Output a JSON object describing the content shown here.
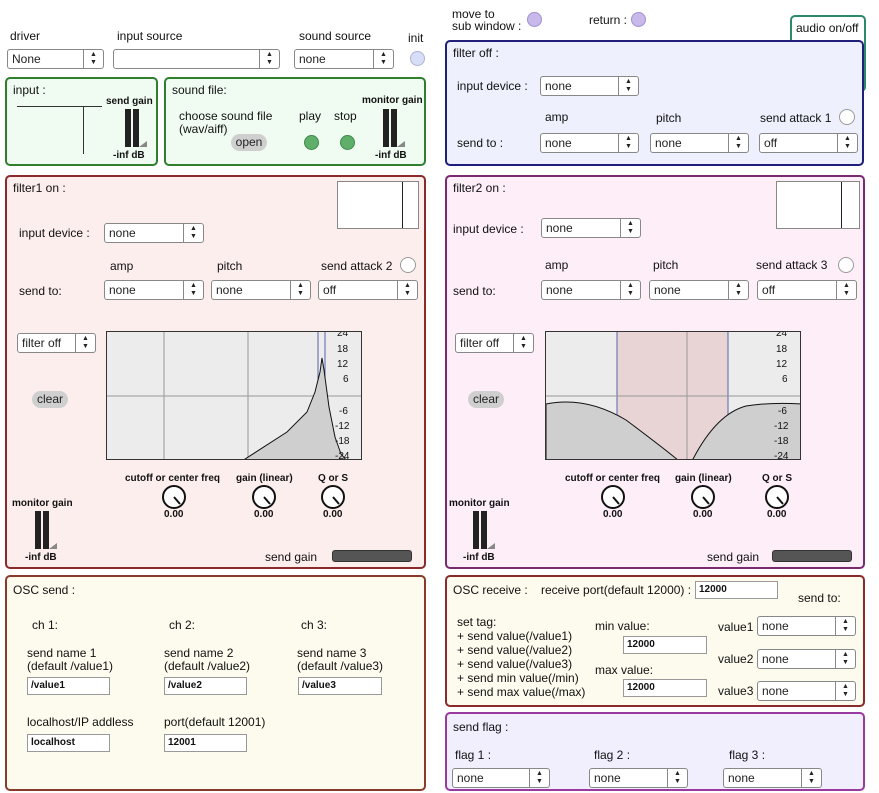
{
  "top": {
    "driver_label": "driver",
    "driver_value": "None",
    "input_source_label": "input source",
    "input_source_value": "",
    "sound_source_label": "sound source",
    "sound_source_value": "none",
    "init_label": "init",
    "move_to_line1": "move to",
    "move_to_line2": "sub window :",
    "return_label": "return :",
    "audio_label": "audio on/off"
  },
  "input_panel": {
    "title": "input :",
    "send_gain_label": "send gain",
    "level_label": "-inf dB"
  },
  "sound_file_panel": {
    "title": "sound file:",
    "choose_line1": "choose sound file",
    "choose_line2": "(wav/aiff)",
    "open_label": "open",
    "play_label": "play",
    "stop_label": "stop",
    "monitor_gain_label": "monitor gain",
    "level_label": "-inf dB"
  },
  "filter_off_panel": {
    "title": "filter off :",
    "input_device_label": "input device :",
    "input_device_value": "none",
    "amp_label": "amp",
    "pitch_label": "pitch",
    "send_attack_label": "send attack 1",
    "send_to_label": "send to :",
    "amp_value": "none",
    "pitch_value": "none",
    "attack_value": "off"
  },
  "filter1": {
    "title": "filter1 on :",
    "input_device_label": "input device :",
    "input_device_value": "none",
    "amp_label": "amp",
    "pitch_label": "pitch",
    "send_attack_label": "send attack 2",
    "send_to_label": "send to:",
    "amp_value": "none",
    "pitch_value": "none",
    "attack_value": "off",
    "filter_mode_value": "filter off",
    "clear_label": "clear",
    "db_ticks": [
      "24",
      "18",
      "12",
      "6",
      "-6",
      "-12",
      "-18",
      "-24"
    ],
    "cutoff_label": "cutoff or center freq",
    "gain_label": "gain (linear)",
    "q_label": "Q or S",
    "cutoff_value": "0.00",
    "gain_value": "0.00",
    "q_value": "0.00",
    "monitor_gain_label": "monitor gain",
    "level_label": "-inf dB",
    "send_gain_label": "send gain"
  },
  "filter2": {
    "title": "filter2 on :",
    "input_device_label": "input device :",
    "input_device_value": "none",
    "amp_label": "amp",
    "pitch_label": "pitch",
    "send_attack_label": "send attack 3",
    "send_to_label": "send to:",
    "amp_value": "none",
    "pitch_value": "none",
    "attack_value": "off",
    "filter_mode_value": "filter off",
    "clear_label": "clear",
    "db_ticks": [
      "24",
      "18",
      "12",
      "6",
      "-6",
      "-12",
      "-18",
      "-24"
    ],
    "cutoff_label": "cutoff or center freq",
    "gain_label": "gain (linear)",
    "q_label": "Q or S",
    "cutoff_value": "0.00",
    "gain_value": "0.00",
    "q_value": "0.00",
    "monitor_gain_label": "monitor gain",
    "level_label": "-inf dB",
    "send_gain_label": "send gain"
  },
  "osc_send": {
    "title": "OSC send :",
    "ch1": "ch 1:",
    "ch2": "ch 2:",
    "ch3": "ch 3:",
    "name1_line1": "send name 1",
    "name1_line2": "(default /value1)",
    "name2_line1": "send name 2",
    "name2_line2": "(default /value2)",
    "name3_line1": "send name 3",
    "name3_line2": "(default /value3)",
    "name1_value": "/value1",
    "name2_value": "/value2",
    "name3_value": "/value3",
    "ip_label": "localhost/IP addless",
    "ip_value": "localhost",
    "port_label": "port(default 12001)",
    "port_value": "12001"
  },
  "osc_receive": {
    "title": "OSC receive :",
    "port_label": "receive port(default 12000) :",
    "port_value": "12000",
    "send_to_label": "send to:",
    "set_tag_lines": [
      "set tag:",
      "+ send value(/value1)",
      "+ send value(/value2)",
      "+ send value(/value3)",
      "+ send min value(/min)",
      "+ send max value(/max)"
    ],
    "min_label": "min value:",
    "min_value": "12000",
    "max_label": "max value:",
    "max_value": "12000",
    "value1_label": "value1",
    "value2_label": "value2",
    "value3_label": "value3",
    "value1_dest": "none",
    "value2_dest": "none",
    "value3_dest": "none"
  },
  "send_flag": {
    "title": "send flag :",
    "flag1_label": "flag 1 :",
    "flag2_label": "flag 2 :",
    "flag3_label": "flag 3 :",
    "flag1_value": "none",
    "flag2_value": "none",
    "flag3_value": "none"
  },
  "colors": {
    "green_border": "#2f7f2f",
    "green_bg": "#f0fcf2",
    "blue_border": "#1f1f7a",
    "blue_bg": "#eef0fd",
    "red_border": "#8a2a2a",
    "red_bg": "#fdeeee",
    "purple_border": "#7a2a6f",
    "pink_bg": "#fdeef8",
    "osc_border": "#8a3a2a",
    "osc_bg": "#fdfaee",
    "flag_border": "#9a3aa0",
    "flag_bg": "#f1eefd",
    "audio_border": "#2a8a6a"
  },
  "icons": {
    "audio": "speaker-icon",
    "move": "purple-led",
    "ret": "purple-led",
    "init": "blue-led"
  }
}
